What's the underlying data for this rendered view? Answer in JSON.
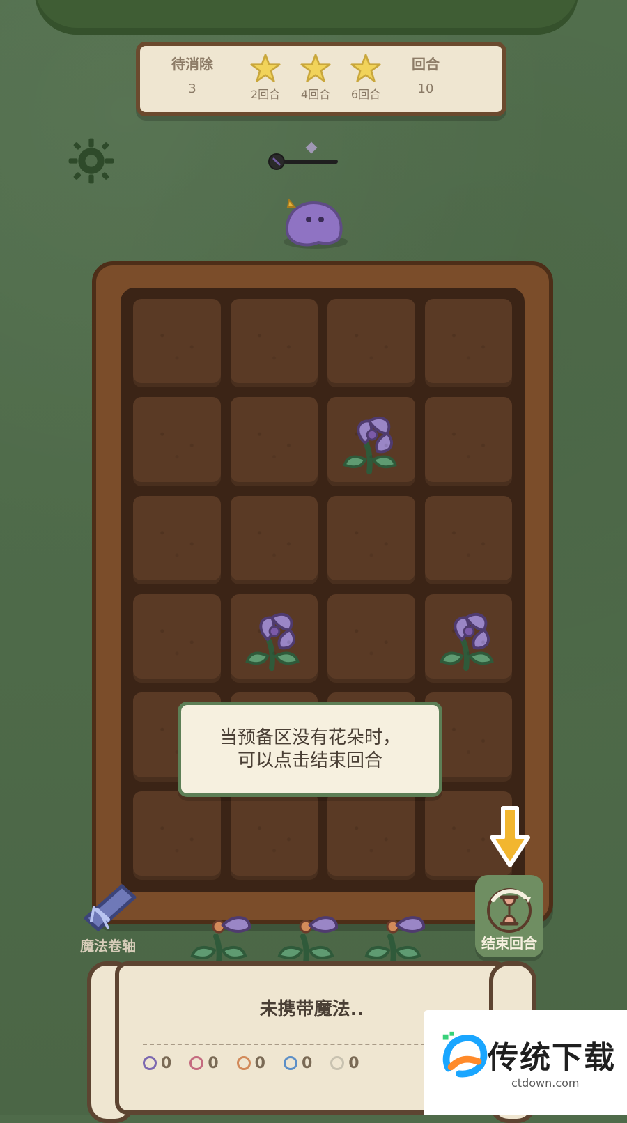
{
  "topbar": {
    "pending_label": "待消除",
    "pending_value": "3",
    "stars": [
      {
        "label": "2回合"
      },
      {
        "label": "4回合"
      },
      {
        "label": "6回合"
      }
    ],
    "round_label": "回合",
    "round_value": "10"
  },
  "tooltip": {
    "line1": "当预备区没有花朵时，",
    "line2": "可以点击结束回合"
  },
  "left_tool": {
    "label": "魔法卷轴"
  },
  "right_action": {
    "label": "结束回合"
  },
  "bottom_panel": {
    "status": "未携带魔法..",
    "counters": [
      {
        "color": "#7c68b0",
        "value": "0"
      },
      {
        "color": "#c46a7f",
        "value": "0"
      },
      {
        "color": "#d28a5a",
        "value": "0"
      },
      {
        "color": "#5c8fc7",
        "value": "0"
      },
      {
        "color": "#c8c2b0",
        "value": "0"
      }
    ]
  },
  "watermark": {
    "name": "传统下载",
    "domain": "ctdown.com"
  },
  "board": {
    "rows": 6,
    "cols": 4,
    "plants": [
      {
        "row": 2,
        "col": 3
      },
      {
        "row": 4,
        "col": 2
      },
      {
        "row": 4,
        "col": 4
      }
    ]
  },
  "colors": {
    "grass": "#4f6b4a",
    "wood": "#7b4d2a",
    "soil": "#5a3a25",
    "accent_green": "#5d7f56",
    "star": "#f1d35a",
    "arrow": "#f2b62f",
    "petal": "#9a86c6"
  }
}
